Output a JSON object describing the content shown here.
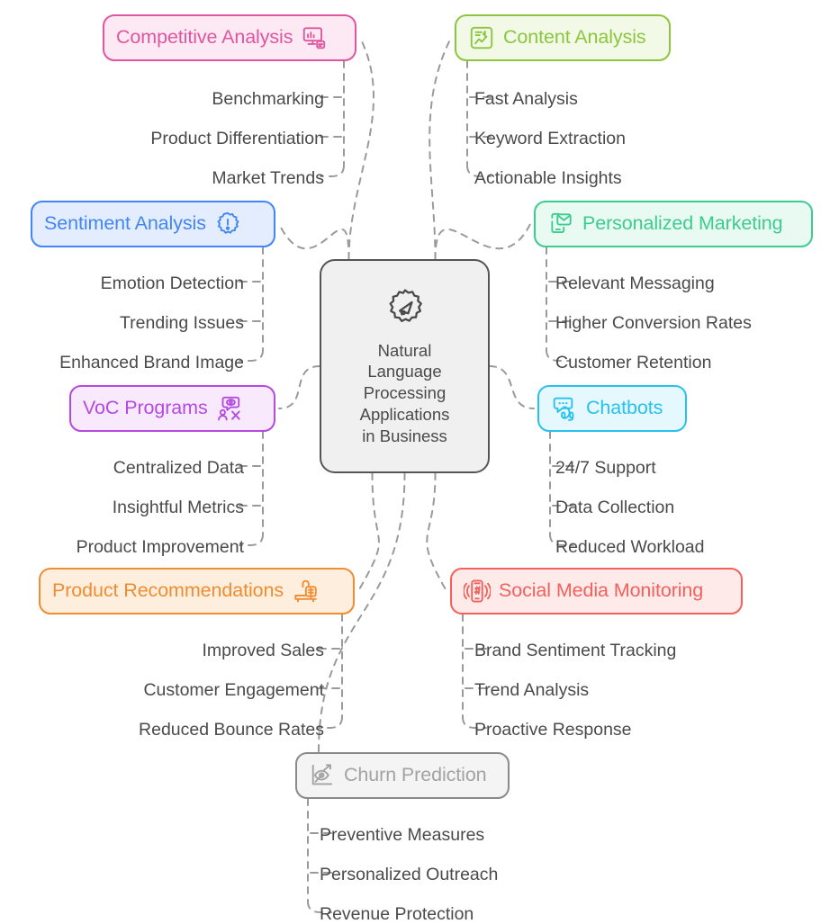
{
  "diagram": {
    "type": "mindmap",
    "background": "#ffffff",
    "edge_color": "#9a9a9a",
    "leaf_text_color": "#4a4a4a"
  },
  "center": {
    "title": "Natural\nLanguage\nProcessing\nApplications\nin Business",
    "icon": "megaphone-badge-icon",
    "border_color": "#555555",
    "fill_color": "#f0f0f0",
    "text_color": "#4a4a4a"
  },
  "branches": [
    {
      "id": "competitive-analysis",
      "label": "Competitive Analysis",
      "icon": "monitor-chart-icon",
      "icon_side": "right",
      "side": "left",
      "color": "#e0569f",
      "border_color": "#e0569f",
      "fill_color": "#fce9f3",
      "children": [
        "Benchmarking",
        "Product Differentiation",
        "Market Trends"
      ]
    },
    {
      "id": "content-analysis",
      "label": "Content Analysis",
      "icon": "document-chart-icon",
      "icon_side": "left",
      "side": "right",
      "color": "#8cc63e",
      "border_color": "#8cc63e",
      "fill_color": "#f2f9e6",
      "children": [
        "Fast Analysis",
        "Keyword Extraction",
        "Actionable Insights"
      ]
    },
    {
      "id": "sentiment-analysis",
      "label": "Sentiment Analysis",
      "icon": "alert-badge-icon",
      "icon_side": "right",
      "side": "left",
      "color": "#4285f4",
      "border_color": "#4285f4",
      "fill_color": "#e3edfd",
      "children": [
        "Emotion Detection",
        "Trending Issues",
        "Enhanced Brand Image"
      ]
    },
    {
      "id": "personalized-marketing",
      "label": "Personalized Marketing",
      "icon": "mobile-mail-icon",
      "icon_side": "left",
      "side": "right",
      "color": "#3dcc8f",
      "border_color": "#3dcc8f",
      "fill_color": "#e8faf1",
      "children": [
        "Relevant Messaging",
        "Higher Conversion Rates",
        "Customer Retention"
      ]
    },
    {
      "id": "voc-programs",
      "label": "VoC Programs",
      "icon": "voice-of-customer-icon",
      "icon_side": "right",
      "side": "left",
      "color": "#b44ae0",
      "border_color": "#b44ae0",
      "fill_color": "#f8e9fd",
      "children": [
        "Centralized Data",
        "Insightful Metrics",
        "Product Improvement"
      ]
    },
    {
      "id": "chatbots",
      "label": "Chatbots",
      "icon": "chat-headset-icon",
      "icon_side": "left",
      "side": "right",
      "color": "#29c0f0",
      "border_color": "#29c0f0",
      "fill_color": "#e4f8fe",
      "children": [
        "24/7 Support",
        "Data Collection",
        "Reduced Workload"
      ]
    },
    {
      "id": "product-recommendations",
      "label": "Product Recommendations",
      "icon": "shopping-basket-icon",
      "icon_side": "right",
      "side": "left",
      "color": "#ef8d33",
      "border_color": "#ef8d33",
      "fill_color": "#fdeedd",
      "children": [
        "Improved Sales",
        "Customer Engagement",
        "Reduced Bounce Rates"
      ]
    },
    {
      "id": "social-media-monitoring",
      "label": "Social Media Monitoring",
      "icon": "hashtag-phone-icon",
      "icon_side": "left",
      "side": "right",
      "color": "#f2615c",
      "border_color": "#f2615c",
      "fill_color": "#fdeae9",
      "children": [
        "Brand Sentiment Tracking",
        "Trend Analysis",
        "Proactive Response"
      ]
    },
    {
      "id": "churn-prediction",
      "label": "Churn Prediction",
      "icon": "eye-trend-icon",
      "icon_side": "left",
      "side": "bottom",
      "color": "#a3a3a3",
      "border_color": "#8a8a8a",
      "fill_color": "#f4f4f4",
      "children": [
        "Preventive Measures",
        "Personalized Outreach",
        "Revenue Protection"
      ]
    }
  ]
}
